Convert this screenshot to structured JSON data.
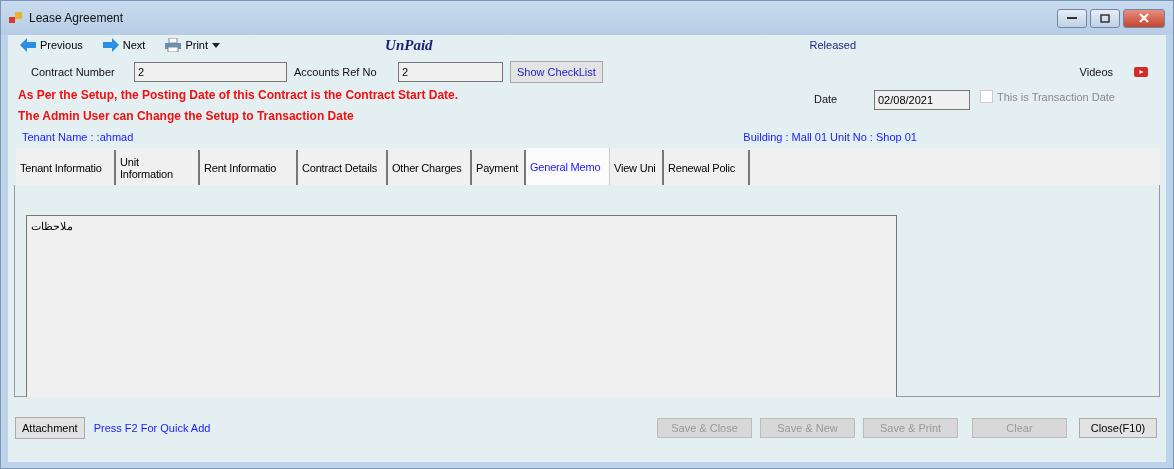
{
  "window": {
    "title": "Lease Agreement"
  },
  "toolbar": {
    "previous": "Previous",
    "next": "Next",
    "print": "Print",
    "payment_status": "UnPaid",
    "release_status": "Released"
  },
  "contract_number": {
    "label": "Contract Number",
    "value": "2"
  },
  "accounts_ref_no": {
    "label": "Accounts Ref No",
    "value": "2"
  },
  "show_checklist": "Show CheckList",
  "videos": "Videos",
  "warnings": [
    "As Per the Setup, the Posting Date of this Contract is the Contract Start Date.",
    "The Admin User can Change the Setup to Transaction Date"
  ],
  "date": {
    "label": "Date",
    "value": "02/08/2021"
  },
  "transaction_date": {
    "label": "This is Transaction Date",
    "checked": false,
    "disabled": true
  },
  "tenant_name": "Tenant Name : :ahmad",
  "building_unit": "Building : Mall 01  Unit No : Shop 01",
  "tabs": [
    {
      "label": "Tenant Informatio",
      "selected": false
    },
    {
      "label": "Unit Information",
      "selected": false
    },
    {
      "label": "Rent Informatio",
      "selected": false
    },
    {
      "label": "Contract Details",
      "selected": false
    },
    {
      "label": "Other Charges",
      "selected": false
    },
    {
      "label": "Payment",
      "selected": false
    },
    {
      "label": "General Memo",
      "selected": true
    },
    {
      "label": "View Uni",
      "selected": false
    },
    {
      "label": "Renewal Polic",
      "selected": false
    }
  ],
  "memo": {
    "value": "ملاحظات"
  },
  "footer": {
    "attachment": "Attachment",
    "hint": "Press F2 For Quick Add",
    "buttons": [
      {
        "label": "Save & Close",
        "disabled": true
      },
      {
        "label": "Save & New",
        "disabled": true
      },
      {
        "label": "Save & Print",
        "disabled": true
      },
      {
        "label": "Clear",
        "disabled": true
      },
      {
        "label": "Close(F10)",
        "disabled": false
      }
    ]
  }
}
